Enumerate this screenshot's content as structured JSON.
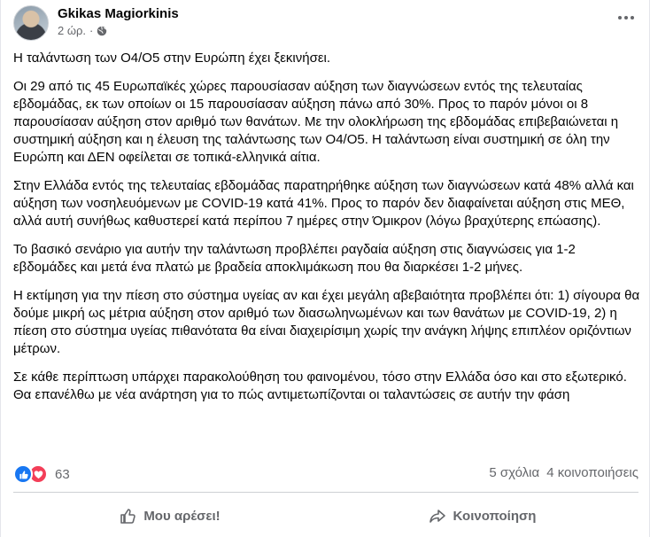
{
  "post": {
    "author": "Gkikas Magiorkinis",
    "time": "2 ώρ.",
    "paragraphs": [
      "Η ταλάντωση των Ο4/Ο5 στην Ευρώπη έχει ξεκινήσει.",
      "Οι 29 από τις 45 Ευρωπαϊκές χώρες παρουσίασαν αύξηση των διαγνώσεων εντός της τελευταίας εβδομάδας, εκ των οποίων οι 15 παρουσίασαν αύξηση πάνω από 30%. Προς το παρόν μόνοι οι 8 παρουσίασαν αύξηση στον αριθμό των θανάτων. Με την ολοκλήρωση της εβδομάδας επιβεβαιώνεται η συστημική αύξηση και η έλευση της ταλάντωσης των Ο4/Ο5. Η ταλάντωση είναι συστημική σε όλη την Ευρώπη και ΔΕΝ οφείλεται σε τοπικά-ελληνικά αίτια.",
      "Στην Ελλάδα εντός της τελευταίας εβδομάδας παρατηρήθηκε αύξηση των διαγνώσεων κατά 48% αλλά και αύξηση των νοσηλευόμενων με COVID-19 κατά 41%. Προς το παρόν δεν διαφαίνεται αύξηση στις ΜΕΘ, αλλά αυτή συνήθως καθυστερεί κατά περίπου 7 ημέρες στην Όμικρον (λόγω βραχύτερης επώασης).",
      "Το βασικό σενάριο για αυτήν την ταλάντωση προβλέπει ραγδαία αύξηση στις διαγνώσεις για 1-2 εβδομάδες και μετά ένα πλατώ με βραδεία αποκλιμάκωση που θα διαρκέσει 1-2 μήνες.",
      "Η εκτίμηση για την πίεση στο σύστημα υγείας αν και έχει μεγάλη αβεβαιότητα προβλέπει ότι: 1) σίγουρα θα δούμε μικρή ως μέτρια αύξηση στον αριθμό των διασωληνωμένων και των θανάτων με COVID-19, 2) η πίεση στο σύστημα υγείας πιθανότατα θα είναι διαχειρίσιμη χωρίς την ανάγκη λήψης επιπλέον οριζόντιων μέτρων.",
      "Σε κάθε περίπτωση υπάρχει παρακολούθηση του φαινομένου, τόσο στην Ελλάδα όσο και στο εξωτερικό. Θα επανέλθω με νέα ανάρτηση για το πώς αντιμετωπίζονται οι ταλαντώσεις σε αυτήν την φάση"
    ]
  },
  "stats": {
    "reactions_count": "63",
    "comments": "5 σχόλια",
    "shares": "4 κοινοποιήσεις"
  },
  "actions": {
    "like_label": "Μου αρέσει!",
    "share_label": "Κοινοποίηση"
  },
  "icons": {
    "globe": "globe-icon",
    "more": "more-options-icon",
    "like_reaction": "like-reaction-icon",
    "love_reaction": "love-reaction-icon",
    "like": "thumbs-up-icon",
    "share": "share-arrow-icon"
  },
  "colors": {
    "like_blue": "#1877f2",
    "love_red": "#f33e58",
    "secondary_text": "#65676b"
  }
}
